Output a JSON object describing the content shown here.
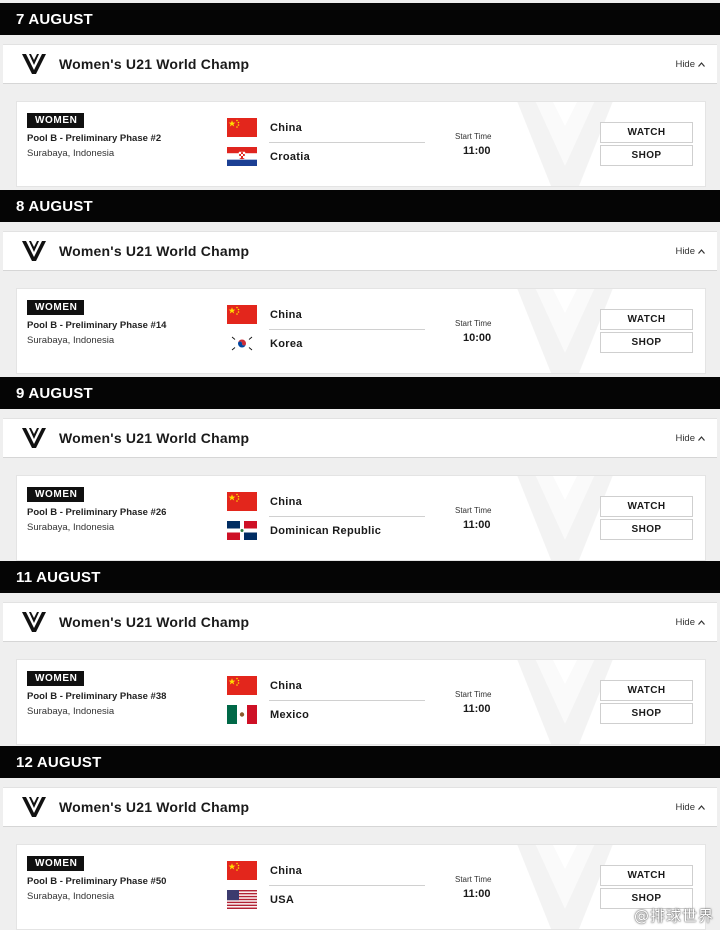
{
  "champ_title": "Women's U21 World Champ",
  "hide_label": "Hide",
  "days": [
    {
      "date": "7 AUGUST",
      "match": {
        "category": "WOMEN",
        "phase": "Pool B - Preliminary Phase #2",
        "location": "Surabaya, Indonesia",
        "team1": {
          "name": "China",
          "flag": "china-flag"
        },
        "team2": {
          "name": "Croatia",
          "flag": "croatia-flag"
        },
        "start_label": "Start Time",
        "start_time": "11:00",
        "watch_label": "WATCH",
        "shop_label": "SHOP"
      }
    },
    {
      "date": "8 AUGUST",
      "match": {
        "category": "WOMEN",
        "phase": "Pool B - Preliminary Phase #14",
        "location": "Surabaya, Indonesia",
        "team1": {
          "name": "China",
          "flag": "china-flag"
        },
        "team2": {
          "name": "Korea",
          "flag": "korea-flag"
        },
        "start_label": "Start Time",
        "start_time": "10:00",
        "watch_label": "WATCH",
        "shop_label": "SHOP"
      }
    },
    {
      "date": "9 AUGUST",
      "match": {
        "category": "WOMEN",
        "phase": "Pool B - Preliminary Phase #26",
        "location": "Surabaya, Indonesia",
        "team1": {
          "name": "China",
          "flag": "china-flag"
        },
        "team2": {
          "name": "Dominican Republic",
          "flag": "dominican-republic-flag"
        },
        "start_label": "Start Time",
        "start_time": "11:00",
        "watch_label": "WATCH",
        "shop_label": "SHOP"
      }
    },
    {
      "date": "11 AUGUST",
      "match": {
        "category": "WOMEN",
        "phase": "Pool B - Preliminary Phase #38",
        "location": "Surabaya, Indonesia",
        "team1": {
          "name": "China",
          "flag": "china-flag"
        },
        "team2": {
          "name": "Mexico",
          "flag": "mexico-flag"
        },
        "start_label": "Start Time",
        "start_time": "11:00",
        "watch_label": "WATCH",
        "shop_label": "SHOP"
      }
    },
    {
      "date": "12 AUGUST",
      "match": {
        "category": "WOMEN",
        "phase": "Pool B - Preliminary Phase #50",
        "location": "Surabaya, Indonesia",
        "team1": {
          "name": "China",
          "flag": "china-flag"
        },
        "team2": {
          "name": "USA",
          "flag": "usa-flag"
        },
        "start_label": "Start Time",
        "start_time": "11:00",
        "watch_label": "WATCH",
        "shop_label": "SHOP"
      }
    }
  ],
  "watermark_text": "@排球世界",
  "colors": {
    "header_bg": "#050505",
    "card_bg": "#ffffff",
    "page_bg": "#efefef"
  }
}
